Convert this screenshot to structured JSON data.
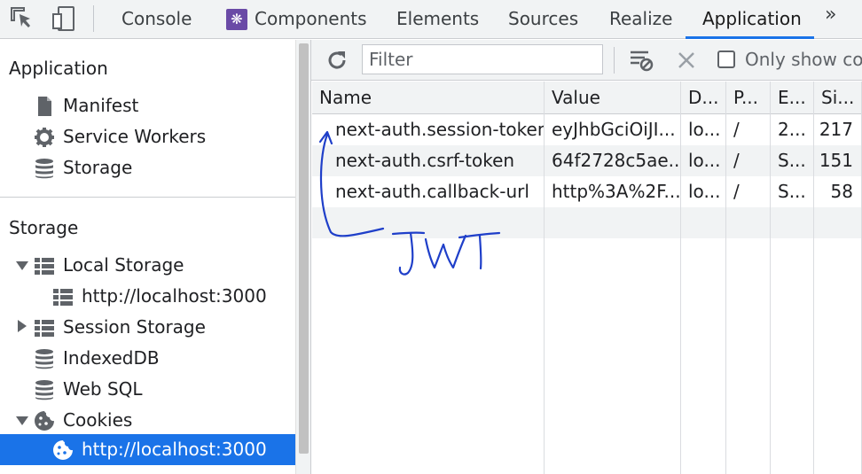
{
  "tabs": {
    "items": [
      {
        "label": "Console"
      },
      {
        "label": "Components"
      },
      {
        "label": "Elements"
      },
      {
        "label": "Sources"
      },
      {
        "label": "Realize"
      },
      {
        "label": "Application"
      }
    ],
    "active": "Application",
    "more_glyph": "»"
  },
  "sidebar": {
    "app_heading": "Application",
    "app_items": [
      {
        "label": "Manifest",
        "icon": "file-icon"
      },
      {
        "label": "Service Workers",
        "icon": "gear-icon"
      },
      {
        "label": "Storage",
        "icon": "database-icon"
      }
    ],
    "storage_heading": "Storage",
    "storage_items": [
      {
        "label": "Local Storage",
        "icon": "grid-icon",
        "expanded": true
      },
      {
        "label": "http://localhost:3000",
        "icon": "grid-icon"
      },
      {
        "label": "Session Storage",
        "icon": "grid-icon",
        "expanded": false
      },
      {
        "label": "IndexedDB",
        "icon": "database-icon"
      },
      {
        "label": "Web SQL",
        "icon": "database-icon"
      },
      {
        "label": "Cookies",
        "icon": "cookie-icon",
        "expanded": true
      },
      {
        "label": "http://localhost:3000",
        "icon": "cookie-icon",
        "selected": true
      }
    ]
  },
  "toolbar": {
    "filter_placeholder": "Filter",
    "only_show_label": "Only show coo"
  },
  "table": {
    "columns": [
      "Name",
      "Value",
      "D...",
      "P...",
      "E...",
      "Si..."
    ],
    "rows": [
      [
        "next-auth.session-token",
        "eyJhbGciOiJI...",
        "lo...",
        "/",
        "2...",
        "217"
      ],
      [
        "next-auth.csrf-token",
        "64f2728c5ae...",
        "lo...",
        "/",
        "S...",
        "151"
      ],
      [
        "next-auth.callback-url",
        "http%3A%2F...",
        "lo...",
        "/",
        "S...",
        "58"
      ]
    ]
  },
  "annotation": {
    "text": "JWT",
    "color": "#1f3fc9"
  },
  "colors": {
    "accent": "#1a73e8",
    "react_purple": "#6a4aa6"
  }
}
